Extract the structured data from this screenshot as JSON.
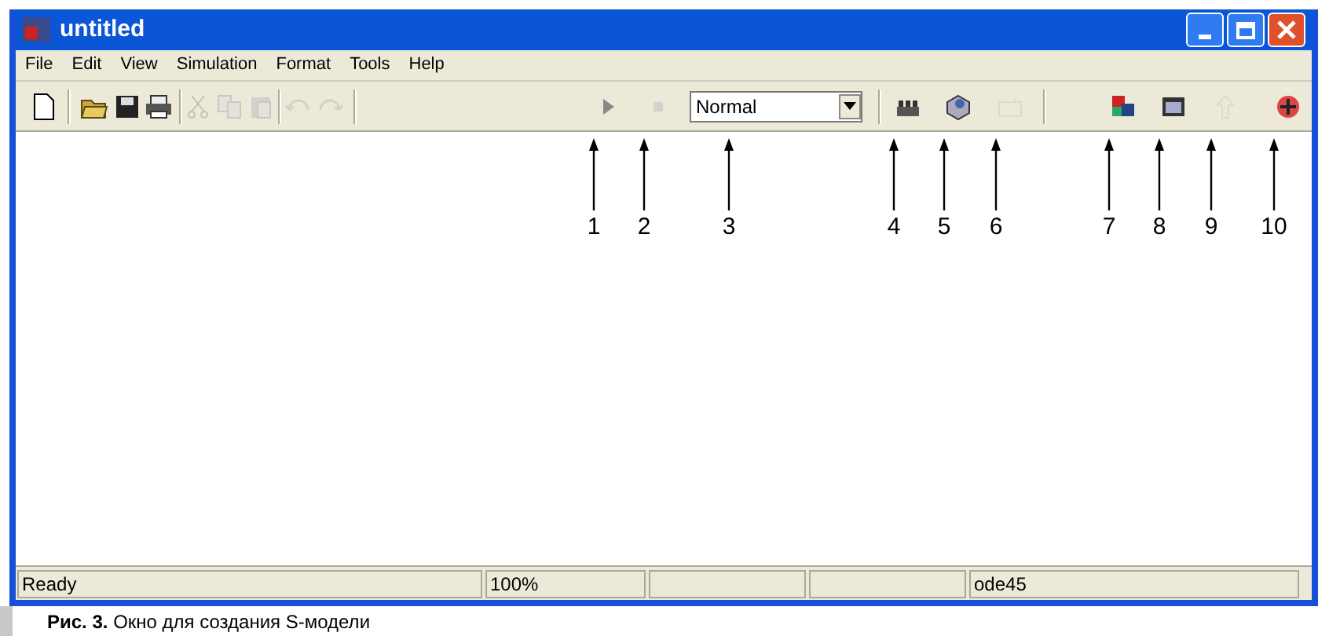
{
  "window": {
    "title": "untitled"
  },
  "menu": [
    {
      "label": "File"
    },
    {
      "label": "Edit"
    },
    {
      "label": "View"
    },
    {
      "label": "Simulation"
    },
    {
      "label": "Format"
    },
    {
      "label": "Tools"
    },
    {
      "label": "Help"
    }
  ],
  "toolbar": [
    {
      "kind": "button",
      "disabled": false
    },
    {
      "kind": "separator"
    },
    {
      "kind": "button",
      "disabled": false
    },
    {
      "kind": "button",
      "disabled": false
    },
    {
      "kind": "button",
      "disabled": false
    },
    {
      "kind": "separator"
    },
    {
      "kind": "button",
      "disabled": true
    },
    {
      "kind": "button",
      "disabled": true
    },
    {
      "kind": "button",
      "disabled": true
    },
    {
      "kind": "separator"
    },
    {
      "kind": "button",
      "disabled": true
    },
    {
      "kind": "button",
      "disabled": true
    },
    {
      "kind": "separator"
    },
    {
      "kind": "button",
      "disabled": false
    },
    {
      "kind": "button",
      "disabled": true
    },
    {
      "kind": "combo",
      "value": "Normal"
    },
    {
      "kind": "separator"
    },
    {
      "kind": "button",
      "disabled": false
    },
    {
      "kind": "button",
      "disabled": false
    },
    {
      "kind": "button",
      "disabled": true
    },
    {
      "kind": "separator"
    },
    {
      "kind": "button",
      "disabled": false
    },
    {
      "kind": "button",
      "disabled": false
    },
    {
      "kind": "button",
      "disabled": true
    },
    {
      "kind": "button",
      "disabled": false
    }
  ],
  "callouts": [
    "1",
    "2",
    "3",
    "4",
    "5",
    "6",
    "7",
    "8",
    "9",
    "10"
  ],
  "status_bar": [
    {
      "text": "Ready"
    },
    {
      "text": "100%"
    },
    {
      "text": "ode45"
    }
  ],
  "caption": "**Рис. 3.** Окно для создания S‑модели"
}
